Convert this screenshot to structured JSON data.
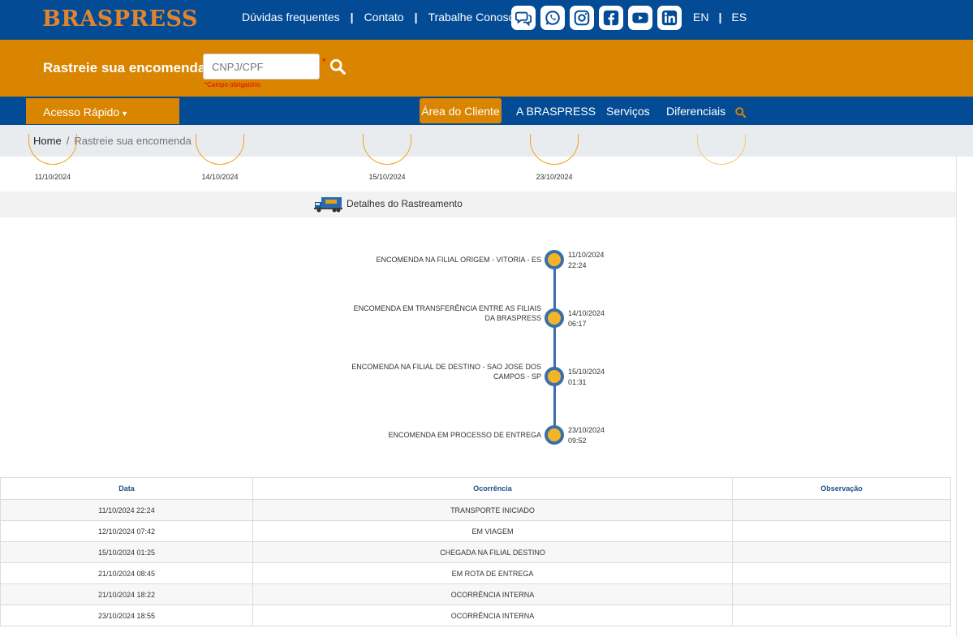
{
  "header": {
    "logo": "BRASPRESS",
    "links": [
      "Dúvidas frequentes",
      "Contato",
      "Trabalhe Conosco"
    ],
    "socials": [
      "chat-icon",
      "whatsapp-icon",
      "instagram-icon",
      "facebook-icon",
      "youtube-icon",
      "linkedin-icon"
    ],
    "languages": [
      "EN",
      "ES"
    ]
  },
  "tracking": {
    "title": "Rastreie sua encomenda",
    "placeholder": "CNPJ/CPF",
    "required_mark": "*",
    "required_note": "*Campo obrigatório"
  },
  "nav": {
    "quick_access": "Acesso Rápido",
    "client_area": "Área do Cliente",
    "about": "A BRASPRESS",
    "services": "Serviços",
    "differentials": "Diferenciais"
  },
  "breadcrumb": {
    "home": "Home",
    "separator": "/",
    "current": "Rastreie sua encomenda"
  },
  "steps": [
    "11/10/2024",
    "14/10/2024",
    "15/10/2024",
    "23/10/2024",
    ""
  ],
  "details": {
    "title": "Detalhes do Rastreamento"
  },
  "events": [
    {
      "text": "ENCOMENDA NA FILIAL ORIGEM - VITORIA - ES",
      "date": "11/10/2024",
      "time": "22:24"
    },
    {
      "text": "ENCOMENDA EM TRANSFERÊNCIA ENTRE AS FILIAIS DA BRASPRESS",
      "date": "14/10/2024",
      "time": "06:17"
    },
    {
      "text": "ENCOMENDA NA FILIAL DE DESTINO - SAO JOSE DOS CAMPOS - SP",
      "date": "15/10/2024",
      "time": "01:31"
    },
    {
      "text": "ENCOMENDA EM PROCESSO DE ENTREGA",
      "date": "23/10/2024",
      "time": "09:52"
    }
  ],
  "table": {
    "headers": [
      "Data",
      "Ocorrência",
      "Observação"
    ],
    "rows": [
      [
        "11/10/2024 22:24",
        "TRANSPORTE INICIADO",
        ""
      ],
      [
        "12/10/2024 07:42",
        "EM VIAGEM",
        ""
      ],
      [
        "15/10/2024 01:25",
        "CHEGADA NA FILIAL DESTINO",
        ""
      ],
      [
        "21/10/2024 08:45",
        "EM ROTA DE ENTREGA",
        ""
      ],
      [
        "21/10/2024 18:22",
        "OCORRÊNCIA INTERNA",
        ""
      ],
      [
        "23/10/2024 18:55",
        "OCORRÊNCIA INTERNA",
        ""
      ]
    ]
  },
  "colors": {
    "primary_blue": "#044b96",
    "accent_orange": "#d98500",
    "logo_orange": "#e0852d",
    "timeline_dot": "#f2b52a"
  }
}
